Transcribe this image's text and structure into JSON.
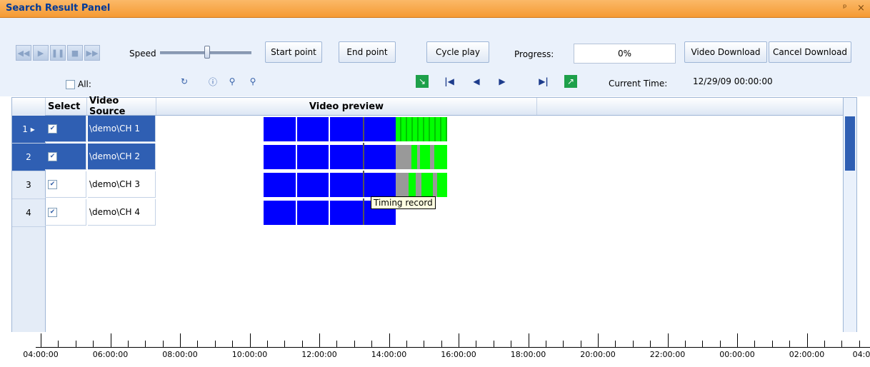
{
  "window": {
    "title": "Search Result Panel",
    "pin_icon": "pin-icon",
    "close_label": "×"
  },
  "toolbar": {
    "speed_label": "Speed",
    "speed_level_fraction": 0.5,
    "start_point": "Start point",
    "end_point": "End point",
    "cycle_play": "Cycle play",
    "progress_label": "Progress:",
    "progress_value": "0%",
    "video_download": "Video Download",
    "cancel_download": "Cancel Download",
    "all_label": "All:",
    "current_time_label": "Current Time:",
    "current_time_value": "12/29/09  00:00:00"
  },
  "grid": {
    "headers": {
      "select": "Select",
      "video_source": "Video Source",
      "video_preview": "Video preview"
    },
    "rows": [
      {
        "num": "1",
        "source": "\\demo\\CH 1",
        "checked": true,
        "selected": true
      },
      {
        "num": "2",
        "source": "\\demo\\CH 2",
        "checked": true,
        "selected": true
      },
      {
        "num": "3",
        "source": "\\demo\\CH 3",
        "checked": true,
        "selected": false
      },
      {
        "num": "4",
        "source": "\\demo\\CH 4",
        "checked": true,
        "selected": false
      }
    ],
    "tooltip": "Timing record"
  },
  "timeline": {
    "labels": [
      "04:00:00",
      "06:00:00",
      "08:00:00",
      "10:00:00",
      "12:00:00",
      "14:00:00",
      "16:00:00",
      "18:00:00",
      "20:00:00",
      "22:00:00",
      "00:00:00",
      "02:00:00",
      "04:0"
    ]
  },
  "colors": {
    "title_bg": "#f59a33",
    "record_blue": "#0000ff",
    "record_green": "#00ff00",
    "record_gray": "#999999",
    "selection": "#2f5fb3"
  }
}
